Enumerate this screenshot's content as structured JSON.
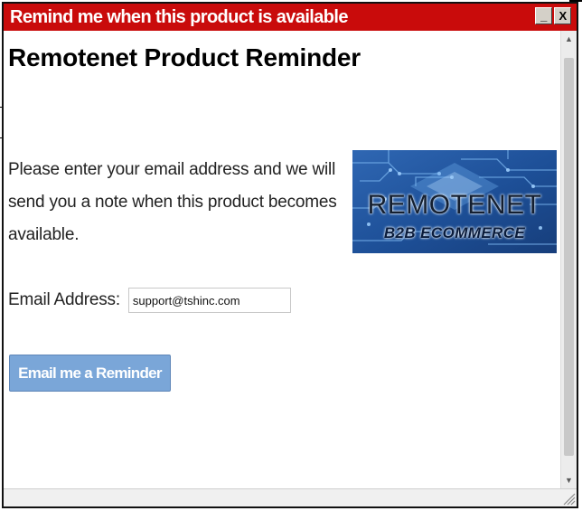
{
  "window": {
    "title": "Remind me when this product is available",
    "minimize_glyph": "_",
    "close_glyph": "X"
  },
  "page": {
    "heading": "Remotenet Product Reminder",
    "intro": "Please enter your email address and we will send you a note when this product becomes available."
  },
  "logo": {
    "word1": "REMOTENET",
    "word2": "B2B ECOMMERCE"
  },
  "form": {
    "email_label": "Email Address:",
    "email_value": "support@tshinc.com",
    "submit_label": "Email me a Reminder"
  },
  "scrollbar": {
    "up_glyph": "▲",
    "down_glyph": "▼"
  },
  "colors": {
    "titlebar": "#c90b0b",
    "button": "#7aa6d8",
    "logo_background": "#1c4e94"
  }
}
